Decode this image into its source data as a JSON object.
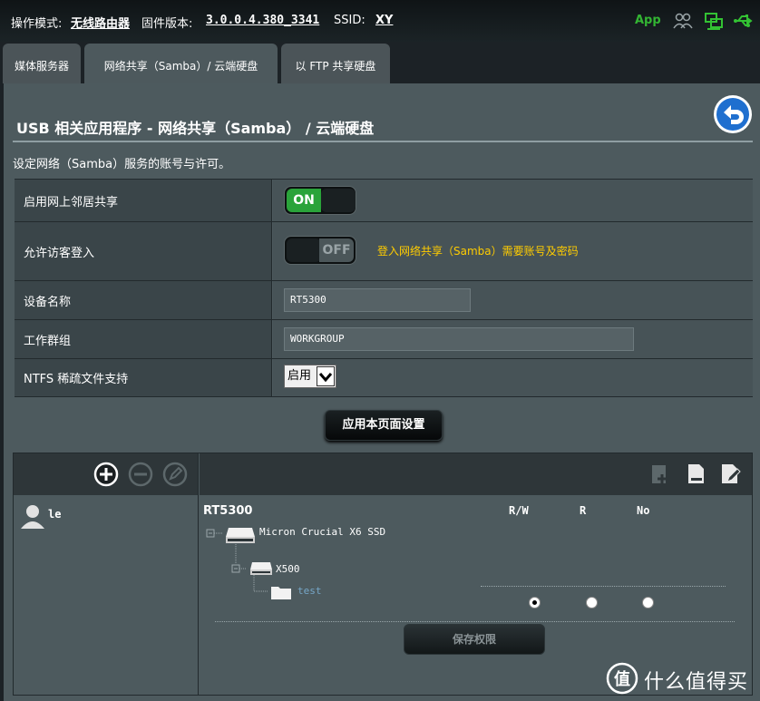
{
  "topbar": {
    "mode_label": "操作模式:",
    "mode_value": "无线路由器",
    "firmware_label": "固件版本:",
    "firmware_value": "3.0.0.4.380_3341",
    "ssid_label": "SSID:",
    "ssid_value": "XY",
    "app_label": "App",
    "icons": [
      "users-icon",
      "network-icon",
      "usb-icon"
    ]
  },
  "tabs": [
    {
      "label": "媒体服务器",
      "active": false
    },
    {
      "label": "网络共享（Samba）/ 云端硬盘",
      "active": true
    },
    {
      "label": "以 FTP 共享硬盘",
      "active": false
    }
  ],
  "page": {
    "title": "USB 相关应用程序 - 网络共享（Samba） / 云端硬盘",
    "description": "设定网络（Samba）服务的账号与许可。"
  },
  "settings": {
    "network_neighborhood": {
      "label": "启用网上邻居共享",
      "state": "ON"
    },
    "guest_login": {
      "label": "允许访客登入",
      "state": "OFF",
      "hint": "登入网络共享（Samba）需要账号及密码"
    },
    "device_name": {
      "label": "设备名称",
      "value": "RT5300"
    },
    "workgroup": {
      "label": "工作群组",
      "value": "WORKGROUP"
    },
    "ntfs": {
      "label": "NTFS 稀疏文件支持",
      "value": "启用"
    }
  },
  "apply_button": "应用本页面设置",
  "permissions": {
    "user": "le",
    "device": "RT5300",
    "columns": [
      "R/W",
      "R",
      "No"
    ],
    "disk": "Micron Crucial X6 SSD",
    "partition": "X500",
    "folder": "test",
    "folder_permission": "R/W",
    "save_button": "保存权限"
  },
  "watermark": {
    "text": "值 什么值得买"
  }
}
